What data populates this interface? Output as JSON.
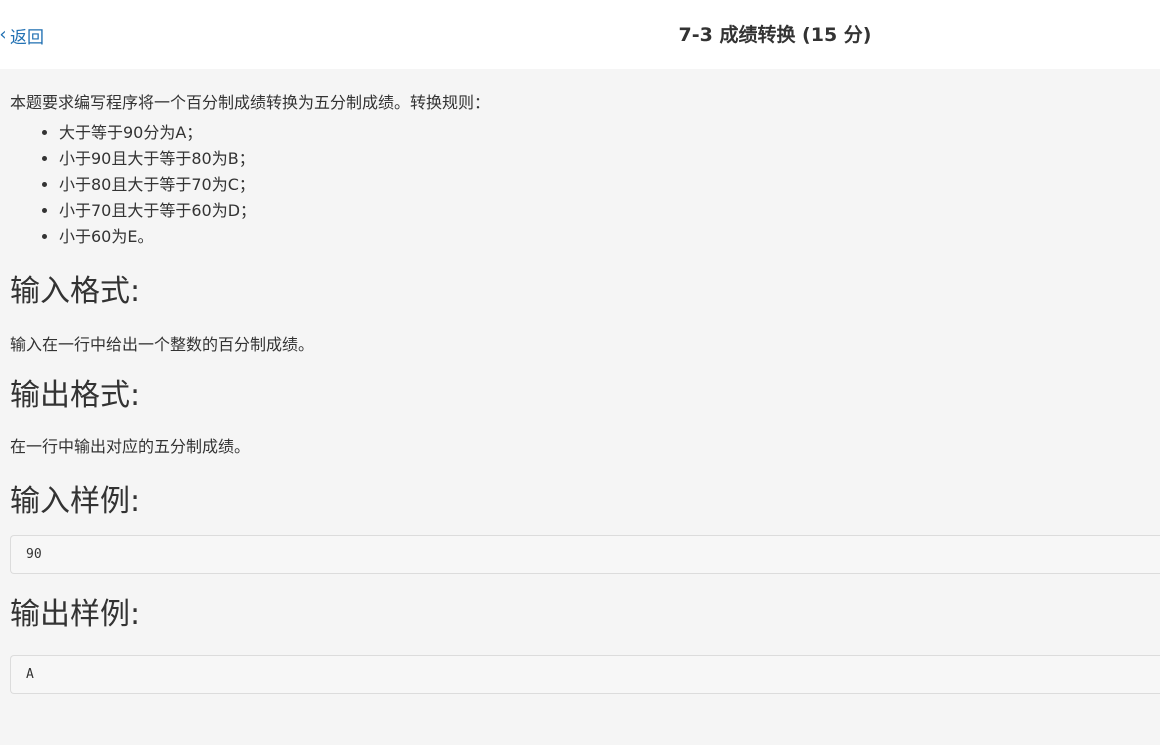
{
  "header": {
    "back_label": "返回",
    "title": "7-3 成绩转换 (15 分)"
  },
  "problem": {
    "intro": "本题要求编写程序将一个百分制成绩转换为五分制成绩。转换规则：",
    "rules": [
      "大于等于90分为A；",
      "小于90且大于等于80为B；",
      "小于80且大于等于70为C；",
      "小于70且大于等于60为D；",
      "小于60为E。"
    ],
    "input_format_heading": "输入格式:",
    "input_format_text": "输入在一行中给出一个整数的百分制成绩。",
    "output_format_heading": "输出格式:",
    "output_format_text": "在一行中输出对应的五分制成绩。",
    "sample_input_heading": "输入样例:",
    "sample_input": "90",
    "sample_output_heading": "输出样例:",
    "sample_output": "A"
  },
  "colors": {
    "link": "#1f6fb2",
    "background": "#f5f5f5",
    "header_bg": "#ffffff",
    "text": "#333333"
  }
}
